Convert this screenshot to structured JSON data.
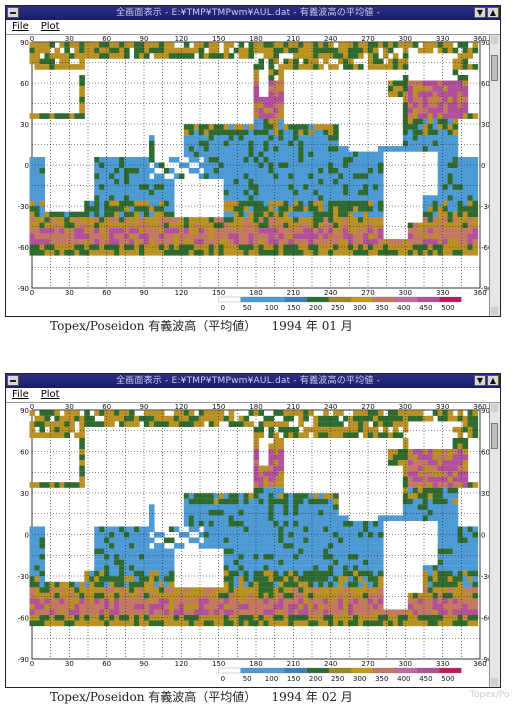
{
  "panels": [
    {
      "window": {
        "title": "全画面表示 - E:¥TMP¥TMPwm¥AUL.dat - 有義波高の平均値 -",
        "menu": [
          "File",
          "Plot"
        ]
      },
      "caption": {
        "text": "Topex/Poseidon 有義波高（平均値）",
        "date": "1994 年 01 月"
      },
      "ghost_text": "Topex/Po"
    },
    {
      "window": {
        "title": "全画面表示 - E:¥TMP¥TMPwm¥AUL.dat - 有義波高の平均値 -",
        "menu": [
          "File",
          "Plot"
        ]
      },
      "caption": {
        "text": "Topex/Poseidon 有義波高（平均値）",
        "date": "1994 年 02 月"
      },
      "ghost_text": "Topex/Po"
    }
  ],
  "map": {
    "lon_ticks": [
      "0",
      "30",
      "60",
      "90",
      "120",
      "150",
      "180",
      "210",
      "240",
      "270",
      "300",
      "330",
      "360"
    ],
    "lat_ticks": [
      "90",
      "60",
      "30",
      "0",
      "-30",
      "-60",
      "-90"
    ],
    "colorbar_labels": [
      "0",
      "50",
      "100",
      "150",
      "200",
      "250",
      "300",
      "350",
      "400",
      "450",
      "500"
    ],
    "colorbar_colors": [
      "#ffffff",
      "#4d9ad4",
      "#4d9ad4",
      "#3b7ec0",
      "#2f6a2f",
      "#9a8a20",
      "#c49a1f",
      "#c47a62",
      "#c16aa0",
      "#b34f9a",
      "#c2175a"
    ],
    "ocean_colors": {
      "calm": "#4d9ad4",
      "mid": "#2f6a2f",
      "high": "#b99125",
      "very_high": "#c47a62",
      "extreme": "#b3509b"
    }
  }
}
